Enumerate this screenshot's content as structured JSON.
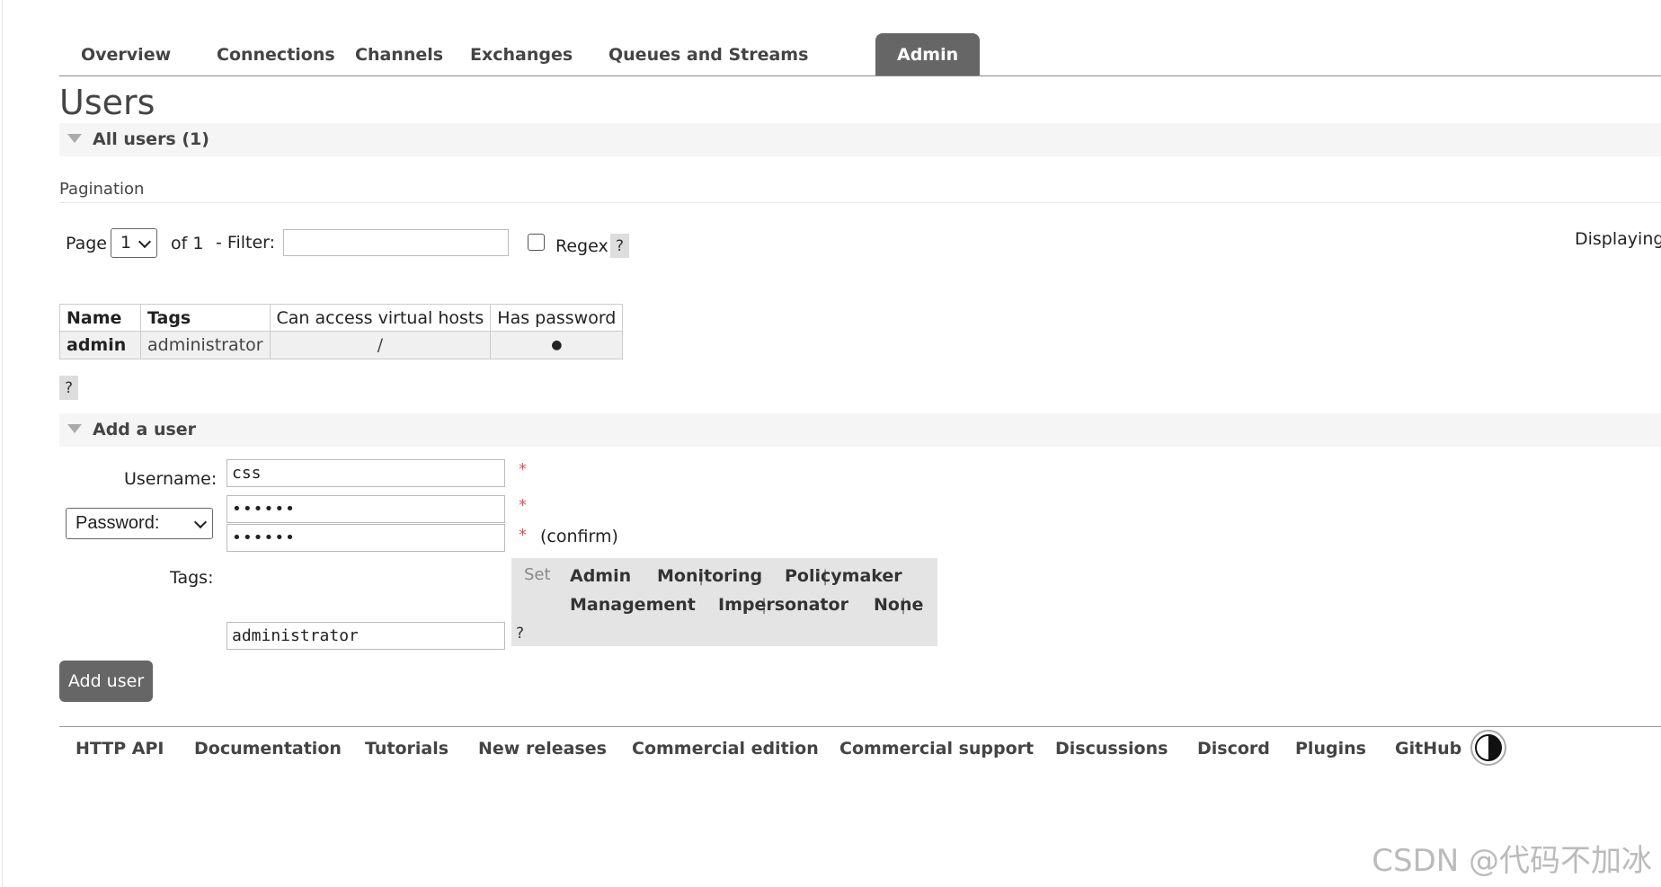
{
  "nav": {
    "tabs": [
      {
        "label": "Overview"
      },
      {
        "label": "Connections"
      },
      {
        "label": "Channels"
      },
      {
        "label": "Exchanges"
      },
      {
        "label": "Queues and Streams"
      },
      {
        "label": "Admin",
        "active": true
      }
    ]
  },
  "page": {
    "title": "Users"
  },
  "all_users": {
    "header": "All users (1)",
    "pagination_title": "Pagination",
    "page_label": "Page",
    "page_value": "1",
    "of_label": "of 1",
    "filter_label": "- Filter:",
    "filter_value": "",
    "regex_label": "Regex",
    "help": "?",
    "displaying": "Displaying",
    "table": {
      "headers": [
        "Name",
        "Tags",
        "Can access virtual hosts",
        "Has password"
      ],
      "rows": [
        {
          "name": "admin",
          "tags": "administrator",
          "vhosts": "/",
          "has_password": "●"
        }
      ]
    }
  },
  "add_user": {
    "header": "Add a user",
    "username_label": "Username:",
    "username_value": "css",
    "password_select": "Password:",
    "password_value": "••••••",
    "confirm_value": "••••••",
    "required": "*",
    "confirm_label": "(confirm)",
    "tags_label": "Tags:",
    "tags_value": "administrator",
    "tag_set_label": "Set",
    "tag_options": [
      "Admin",
      "Monitoring",
      "Policymaker",
      "Management",
      "Impersonator",
      "None"
    ],
    "tag_separator": "|",
    "help": "?",
    "submit_label": "Add user"
  },
  "footer": {
    "links": [
      "HTTP API",
      "Documentation",
      "Tutorials",
      "New releases",
      "Commercial edition",
      "Commercial support",
      "Discussions",
      "Discord",
      "Plugins",
      "GitHub"
    ]
  },
  "watermark": "CSDN @代码不加冰",
  "colors": {
    "accent": "#666666",
    "required": "#e25555",
    "panel": "#e4e4e4"
  }
}
